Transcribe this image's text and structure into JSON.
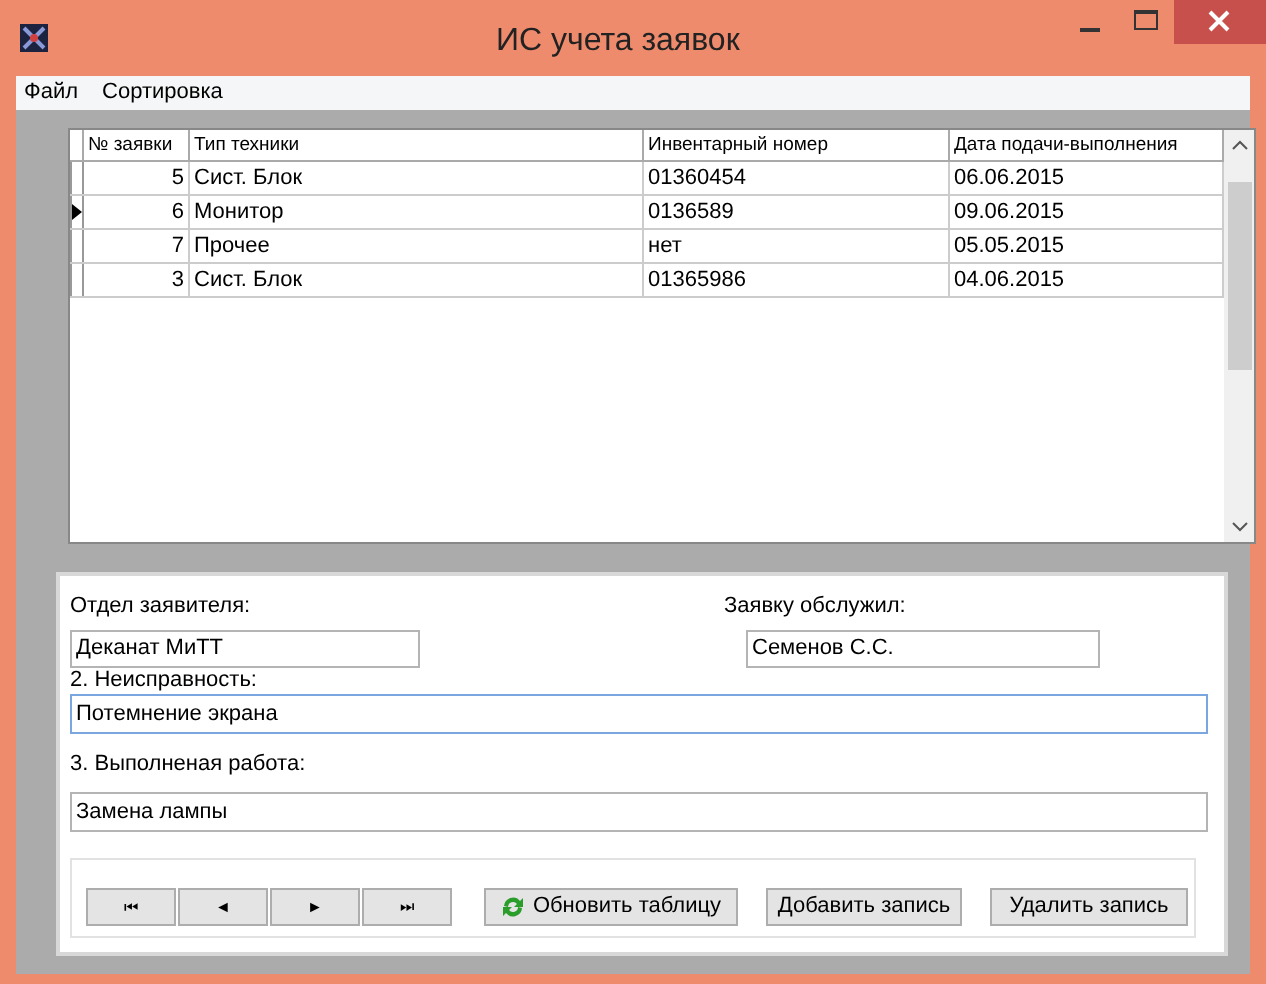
{
  "window": {
    "title": "ИС учета заявок"
  },
  "menu": [
    "Файл",
    "Сортировка"
  ],
  "table": {
    "columns": [
      "№ заявки",
      "Тип техники",
      "Инвентарный номер",
      "Дата подачи-выполнения"
    ],
    "rows": [
      {
        "cells": [
          "5",
          "Сист. Блок",
          "01360454",
          "06.06.2015"
        ],
        "selected": false
      },
      {
        "cells": [
          "6",
          "Монитор",
          "0136589",
          "09.06.2015"
        ],
        "selected": true
      },
      {
        "cells": [
          "7",
          "Прочее",
          "нет",
          "05.05.2015"
        ],
        "selected": false
      },
      {
        "cells": [
          "3",
          "Сист. Блок",
          "01365986",
          "04.06.2015"
        ],
        "selected": false
      }
    ]
  },
  "form": {
    "department": {
      "label": "Отдел заявителя:",
      "value": "Деканат МиТТ",
      "focused": false
    },
    "served_by": {
      "label": "Заявку обслужил:",
      "value": "Семенов С.С.",
      "focused": false
    },
    "fault": {
      "label": "2. Неисправность:",
      "value": "Потемнение экрана",
      "focused": true
    },
    "work": {
      "label": "3. Выполненая работа:",
      "value": "Замена лампы",
      "focused": false
    }
  },
  "navigator": [
    "⏮",
    "◄",
    "►",
    "⏭"
  ],
  "buttons": [
    {
      "label": "Обновить таблицу",
      "kind": "refresh"
    },
    {
      "label": "Добавить запись",
      "kind": "plain"
    },
    {
      "label": "Удалить запись",
      "kind": "plain"
    }
  ]
}
